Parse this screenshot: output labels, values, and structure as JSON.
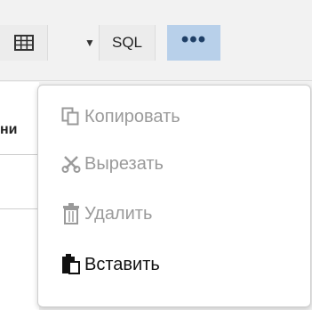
{
  "toolbar": {
    "table_button": "table-grid",
    "sql_label": "SQL",
    "more_label": "•••"
  },
  "background": {
    "left_label": "ни"
  },
  "menu": {
    "items": [
      {
        "label": "Копировать",
        "icon": "copy-icon",
        "enabled": false
      },
      {
        "label": "Вырезать",
        "icon": "scissors-icon",
        "enabled": false
      },
      {
        "label": "Удалить",
        "icon": "trash-icon",
        "enabled": false
      },
      {
        "label": "Вставить",
        "icon": "paste-icon",
        "enabled": true
      }
    ]
  },
  "colors": {
    "more_button_bg": "#b8d0ea",
    "disabled_text": "#9a9a9a",
    "enabled_text": "#111111"
  }
}
